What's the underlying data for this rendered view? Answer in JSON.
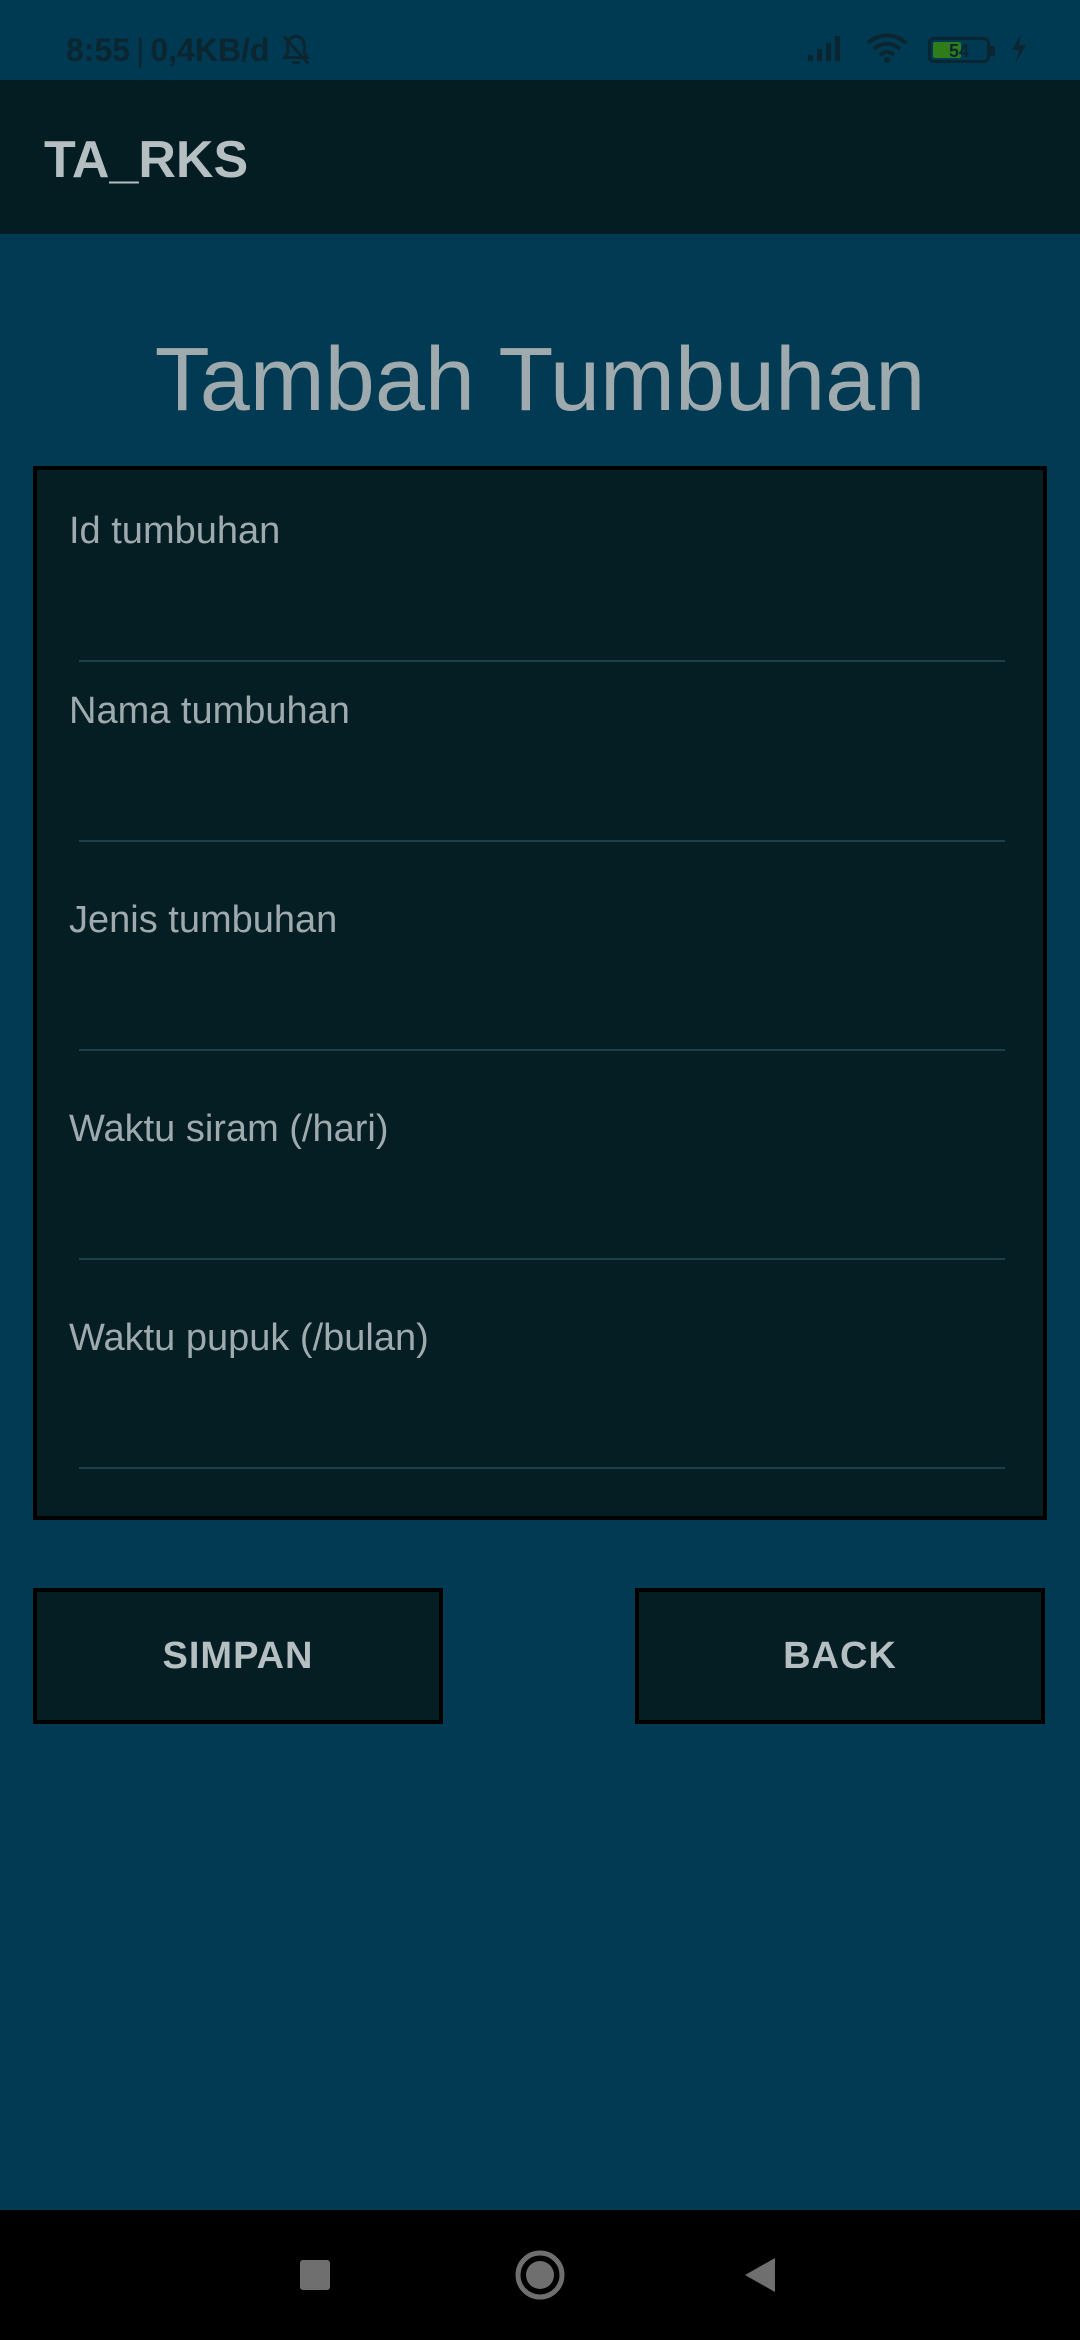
{
  "status_bar": {
    "time": "8:55",
    "separator": "|",
    "data_rate": "0,4KB/d",
    "battery_level": "54",
    "battery_fraction": 0.54,
    "icons": [
      "bell-off-icon",
      "signal-icon",
      "wifi-icon",
      "battery-icon",
      "charging-icon"
    ]
  },
  "app_bar": {
    "title": "TA_RKS"
  },
  "page": {
    "heading": "Tambah Tumbuhan"
  },
  "form": {
    "fields": [
      {
        "label": "Id tumbuhan",
        "value": ""
      },
      {
        "label": "Nama tumbuhan",
        "value": ""
      },
      {
        "label": "Jenis tumbuhan",
        "value": ""
      },
      {
        "label": "Waktu siram (/hari)",
        "value": ""
      },
      {
        "label": "Waktu pupuk (/bulan)",
        "value": ""
      }
    ]
  },
  "buttons": {
    "save_label": "SIMPAN",
    "back_label": "BACK"
  },
  "nav_bar": {
    "icons": [
      "recent-apps-icon",
      "home-icon",
      "back-icon"
    ]
  },
  "colors": {
    "background": "#013a52",
    "app_bar": "#031d22",
    "card": "#041e23",
    "text": "#b5bfc2",
    "battery_green": "#2e7d1a"
  }
}
